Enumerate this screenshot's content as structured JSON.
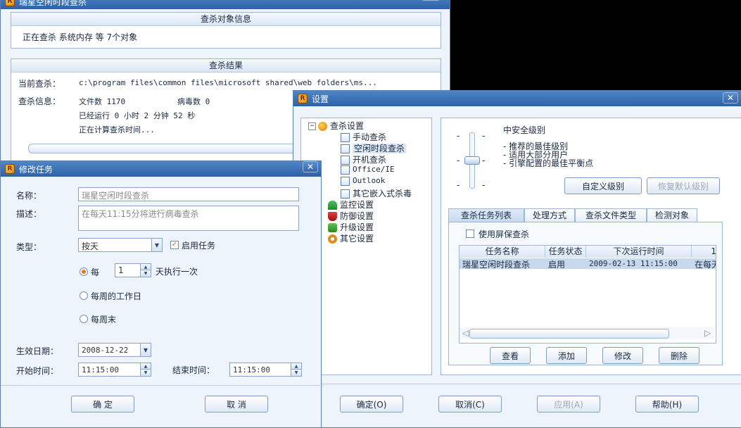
{
  "back_window": {
    "title": "瑞星空闲时段查杀",
    "targets_header": "查杀对象信息",
    "targets_text": "正在查杀 系统内存 等 7个对象",
    "results_header": "查杀结果",
    "current_label": "当前查杀：",
    "current_value": "c:\\program files\\common files\\microsoft shared\\web folders\\ms...",
    "info_label": "查杀信息：",
    "files_text": "文件数 1170",
    "virus_text": "病毒数 0",
    "elapsed_text": "已经运行 0 小时 2 分钟 52  秒",
    "calc_text": "正在计算查杀时间..."
  },
  "modify_dialog": {
    "title": "修改任务",
    "name_label": "名称：",
    "name_value": "瑞星空闲时段查杀",
    "desc_label": "描述：",
    "desc_value": "在每天11:15分将进行病毒查杀",
    "type_label": "类型：",
    "type_value": "按天",
    "enable_label": "启用任务",
    "every_label": "每",
    "every_value": "1",
    "every_suffix": "天执行一次",
    "weekday_label": "每周的工作日",
    "weekend_label": "每周末",
    "date_label": "生效日期：",
    "date_value": "2008-12-22",
    "start_label": "开始时间：",
    "start_value": "11:15:00",
    "end_label": "结束时间：",
    "end_value": "11:15:00",
    "ok_label": "确 定",
    "cancel_label": "取 消"
  },
  "settings": {
    "title": "设置",
    "tree": {
      "root": "查杀设置",
      "children": [
        "手动查杀",
        "空闲时段查杀",
        "开机查杀",
        "Office/IE",
        "Outlook",
        "其它嵌入式杀毒"
      ],
      "others": [
        "监控设置",
        "防御设置",
        "升级设置",
        "其它设置"
      ]
    },
    "level_title": "中安全级别",
    "level_lines": [
      "- 推荐的最佳级别",
      "- 适用大部分用户",
      "- 引擎配置的最佳平衡点"
    ],
    "custom_level": "自定义级别",
    "restore_level": "恢复默认级别",
    "tabs": [
      "查杀任务列表",
      "处理方式",
      "查杀文件类型",
      "检测对象"
    ],
    "screensaver_label": "使用屏保查杀",
    "columns": [
      "任务名称",
      "任务状态",
      "下次运行时间",
      "1"
    ],
    "row": [
      "瑞星空闲时段查杀",
      "启用",
      "2009-02-13  11:15:00",
      "在每天"
    ],
    "list_buttons": [
      "查看",
      "添加",
      "修改",
      "删除"
    ],
    "ok_label": "确定(O)",
    "cancel_label": "取消(C)",
    "apply_label": "应用(A)",
    "help_label": "帮助(H)"
  },
  "colors": {
    "title_bar": "#2d62a8",
    "accent": "#e57a10",
    "selection": "#c7d9ef"
  }
}
